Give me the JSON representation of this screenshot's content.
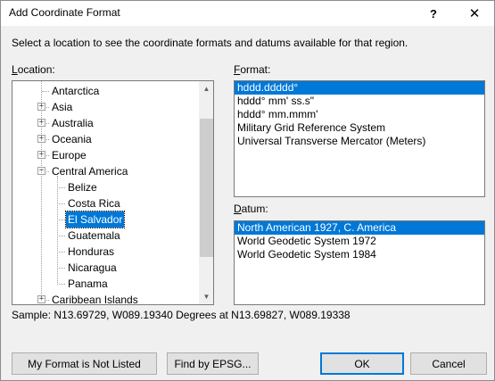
{
  "window": {
    "title": "Add Coordinate Format",
    "help_glyph": "?",
    "close_glyph": "✕"
  },
  "instruction": "Select a location to see the coordinate formats and datums available for that region.",
  "location": {
    "label_access_key": "L",
    "label_rest": "ocation:",
    "items": [
      {
        "label": "Antarctica",
        "expandable": false,
        "expanded": false,
        "selected": false
      },
      {
        "label": "Asia",
        "expandable": true,
        "expanded": false,
        "selected": false
      },
      {
        "label": "Australia",
        "expandable": true,
        "expanded": false,
        "selected": false
      },
      {
        "label": "Oceania",
        "expandable": true,
        "expanded": false,
        "selected": false
      },
      {
        "label": "Europe",
        "expandable": true,
        "expanded": false,
        "selected": false
      },
      {
        "label": "Central America",
        "expandable": true,
        "expanded": true,
        "selected": false
      },
      {
        "label": "Belize",
        "expandable": false,
        "expanded": false,
        "selected": false
      },
      {
        "label": "Costa Rica",
        "expandable": false,
        "expanded": false,
        "selected": false
      },
      {
        "label": "El Salvador",
        "expandable": false,
        "expanded": false,
        "selected": true
      },
      {
        "label": "Guatemala",
        "expandable": false,
        "expanded": false,
        "selected": false
      },
      {
        "label": "Honduras",
        "expandable": false,
        "expanded": false,
        "selected": false
      },
      {
        "label": "Nicaragua",
        "expandable": false,
        "expanded": false,
        "selected": false
      },
      {
        "label": "Panama",
        "expandable": false,
        "expanded": false,
        "selected": false
      },
      {
        "label": "Caribbean Islands",
        "expandable": true,
        "expanded": false,
        "selected": false
      }
    ]
  },
  "format": {
    "label_access_key": "F",
    "label_rest": "ormat:",
    "items": [
      {
        "label": "hddd.ddddd°",
        "selected": true
      },
      {
        "label": "hddd° mm' ss.s\"",
        "selected": false
      },
      {
        "label": "hddd° mm.mmm'",
        "selected": false
      },
      {
        "label": "Military Grid Reference System",
        "selected": false
      },
      {
        "label": "Universal Transverse Mercator (Meters)",
        "selected": false
      }
    ]
  },
  "datum": {
    "label_access_key": "D",
    "label_rest": "atum:",
    "items": [
      {
        "label": "North American 1927, C. America",
        "selected": true
      },
      {
        "label": "World Geodetic System 1972",
        "selected": false
      },
      {
        "label": "World Geodetic System 1984",
        "selected": false
      }
    ]
  },
  "sample": "Sample: N13.69729, W089.19340 Degrees at N13.69827, W089.19338",
  "buttons": {
    "my_format": "My Format is Not Listed",
    "find_epsg": "Find by EPSG...",
    "ok": "OK",
    "cancel": "Cancel"
  },
  "icons": {
    "collapsed": "+",
    "expanded": "−",
    "scroll_up": "▲",
    "scroll_down": "▼"
  },
  "colors": {
    "selection": "#0078d7",
    "dialog_bg": "#f0f0f0"
  }
}
